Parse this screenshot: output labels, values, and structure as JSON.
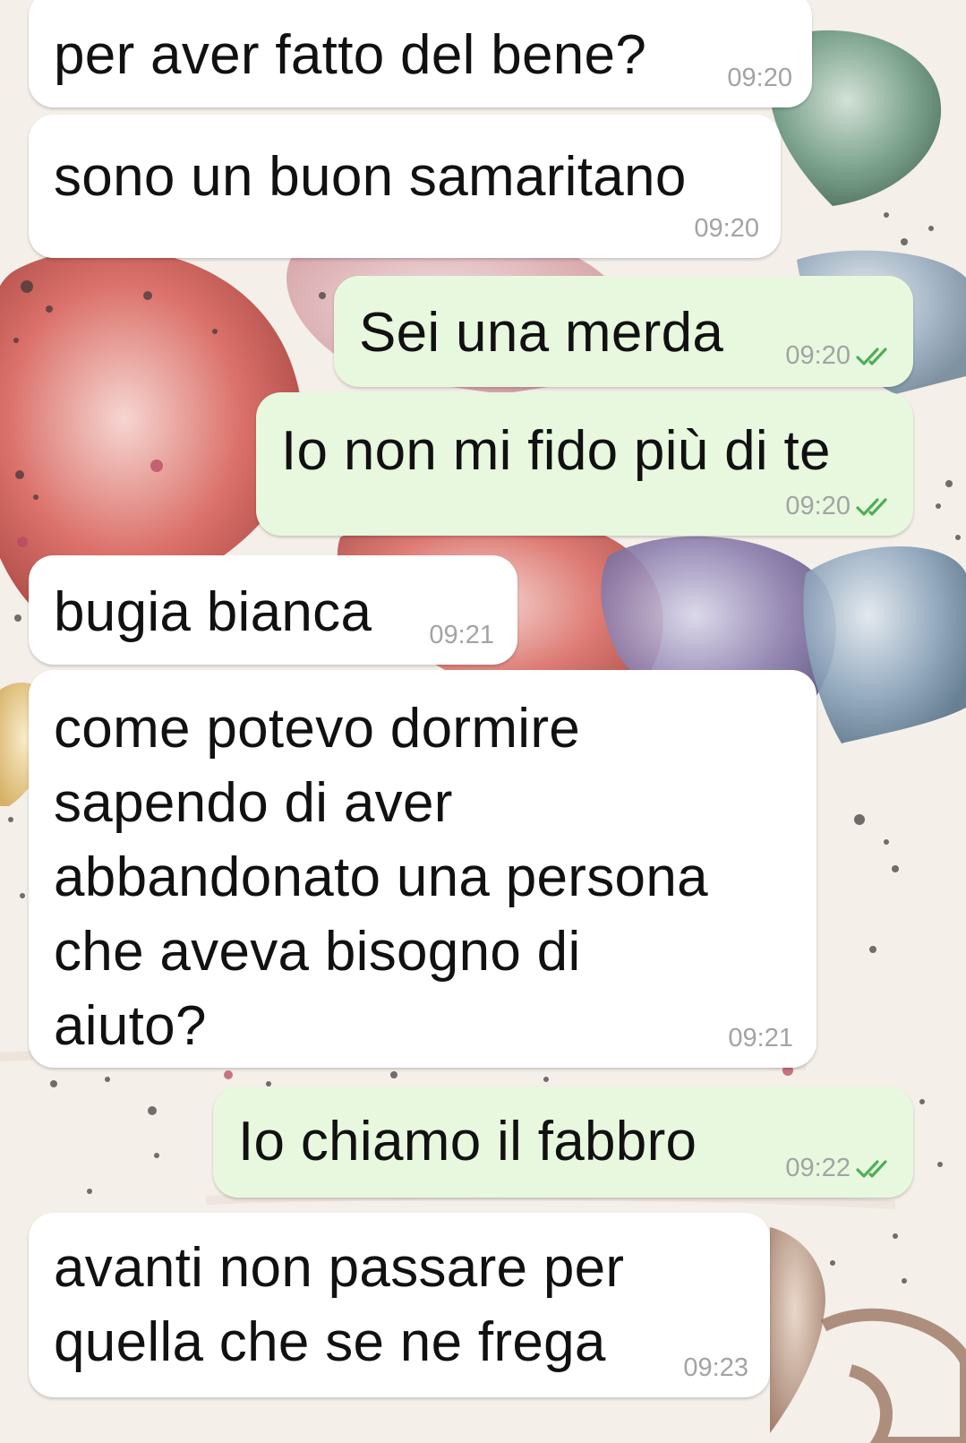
{
  "theme": {
    "incoming_bubble": "#ffffff",
    "outgoing_bubble": "#e7f8df",
    "read_tick_color": "#4fae57",
    "timestamp_color": "#a3a3a3",
    "wallpaper": "watercolor-hearts"
  },
  "messages": [
    {
      "direction": "incoming",
      "lines": [
        "per aver fatto del bene?"
      ],
      "time": "09:20"
    },
    {
      "direction": "incoming",
      "lines": [
        "sono un buon samaritano"
      ],
      "time": "09:20"
    },
    {
      "direction": "outgoing",
      "lines": [
        "Sei una merda"
      ],
      "time": "09:20",
      "status": "read"
    },
    {
      "direction": "outgoing",
      "lines": [
        "Io non mi fido più di te"
      ],
      "time": "09:20",
      "status": "read"
    },
    {
      "direction": "incoming",
      "lines": [
        "bugia bianca"
      ],
      "time": "09:21"
    },
    {
      "direction": "incoming",
      "lines": [
        "come potevo dormire",
        "sapendo di aver",
        "abbandonato una persona",
        "che aveva bisogno di",
        "aiuto?"
      ],
      "time": "09:21"
    },
    {
      "direction": "outgoing",
      "lines": [
        "Io chiamo il fabbro"
      ],
      "time": "09:22",
      "status": "read"
    },
    {
      "direction": "incoming",
      "lines": [
        "avanti non passare per",
        "quella che se ne frega"
      ],
      "time": "09:23"
    }
  ]
}
